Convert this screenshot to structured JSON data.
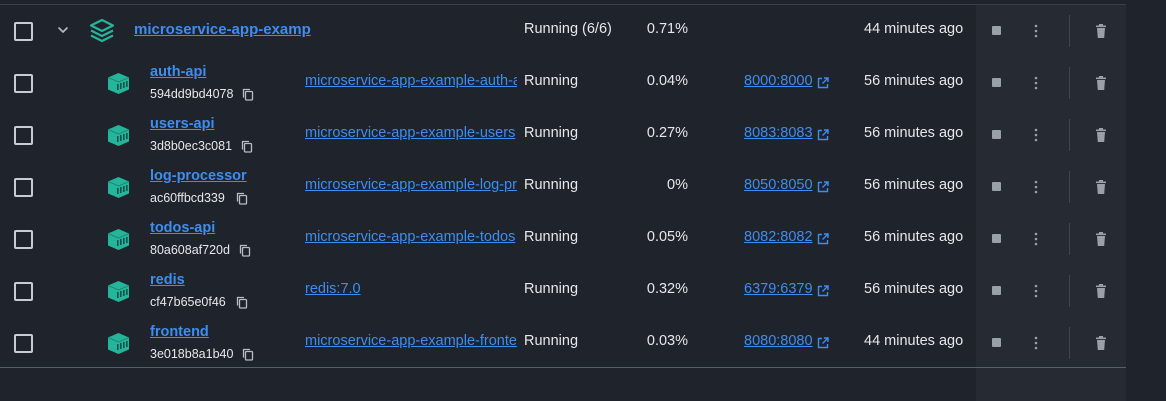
{
  "colors": {
    "accent": "#3d8ef0",
    "container_icon": "#25b59a",
    "background": "#1f232b"
  },
  "group": {
    "name": "microservice-app-examp",
    "status": "Running (6/6)",
    "cpu": "0.71%",
    "last_started": "44 minutes ago",
    "icon": "stack-icon"
  },
  "containers": [
    {
      "name": "auth-api",
      "id": "594dd9bd4078",
      "image": "microservice-app-example-auth-a",
      "status": "Running",
      "cpu": "0.04%",
      "port": "8000:8000",
      "last_started": "56 minutes ago"
    },
    {
      "name": "users-api",
      "id": "3d8b0ec3c081",
      "image": "microservice-app-example-users",
      "status": "Running",
      "cpu": "0.27%",
      "port": "8083:8083",
      "last_started": "56 minutes ago"
    },
    {
      "name": "log-processor",
      "id": "ac60ffbcd339",
      "image": "microservice-app-example-log-pr",
      "status": "Running",
      "cpu": "0%",
      "port": "8050:8050",
      "last_started": "56 minutes ago"
    },
    {
      "name": "todos-api",
      "id": "80a608af720d",
      "image": "microservice-app-example-todos",
      "status": "Running",
      "cpu": "0.05%",
      "port": "8082:8082",
      "last_started": "56 minutes ago"
    },
    {
      "name": "redis",
      "id": "cf47b65e0f46",
      "image": "redis:7.0",
      "status": "Running",
      "cpu": "0.32%",
      "port": "6379:6379",
      "last_started": "56 minutes ago"
    },
    {
      "name": "frontend",
      "id": "3e018b8a1b40",
      "image": "microservice-app-example-fronte",
      "status": "Running",
      "cpu": "0.03%",
      "port": "8080:8080",
      "last_started": "44 minutes ago"
    }
  ]
}
